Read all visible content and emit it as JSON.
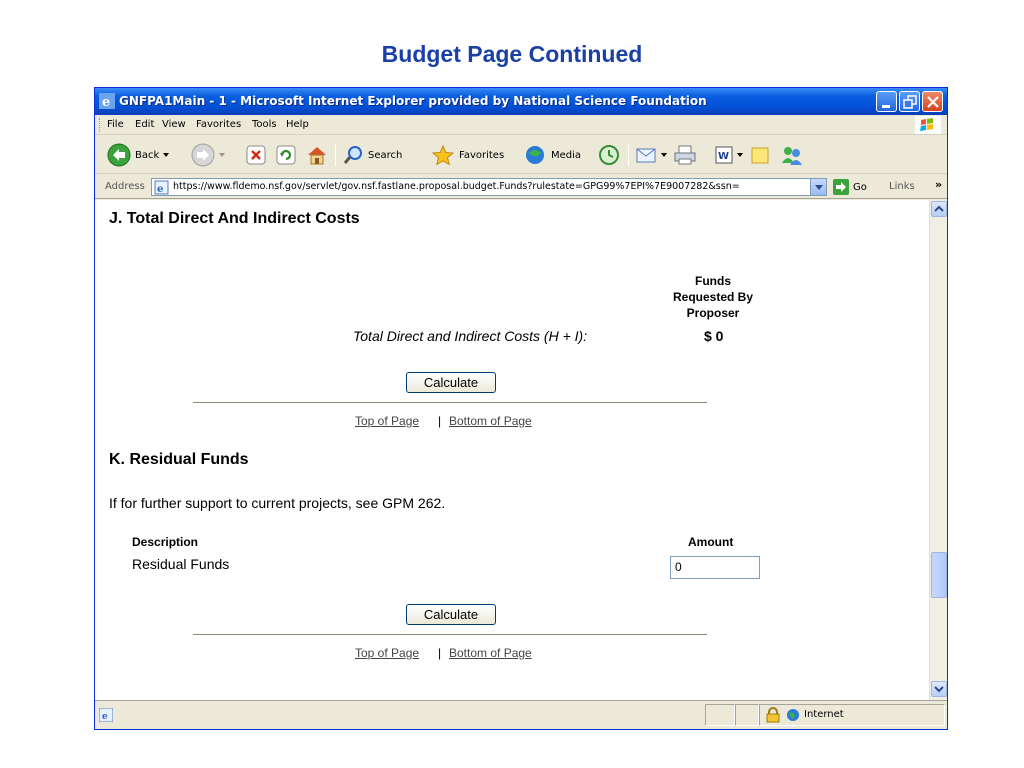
{
  "slide_title": "Budget Page Continued",
  "window": {
    "title": "GNFPA1Main - 1 - Microsoft Internet Explorer provided by National Science Foundation",
    "menu": [
      "File",
      "Edit",
      "View",
      "Favorites",
      "Tools",
      "Help"
    ],
    "toolbar": {
      "back": "Back",
      "search": "Search",
      "favorites": "Favorites",
      "media": "Media"
    },
    "address": {
      "label": "Address",
      "url": "https://www.fldemo.nsf.gov/servlet/gov.nsf.fastlane.proposal.budget.Funds?rulestate=GPG99%7EPI%7E9007282&ssn=",
      "go": "Go",
      "links": "Links"
    },
    "status": {
      "zone": "Internet"
    }
  },
  "page": {
    "section_j": {
      "heading": "J. Total Direct And Indirect Costs",
      "column_header": [
        "Funds",
        "Requested By",
        "Proposer"
      ],
      "row_label": "Total Direct and Indirect Costs (H + I):",
      "row_value": "$ 0",
      "calculate": "Calculate",
      "top_link": "Top of Page",
      "bottom_link": "Bottom of Page"
    },
    "section_k": {
      "heading": "K. Residual Funds",
      "note": "If for further support to current projects, see GPM 262.",
      "col_description": "Description",
      "col_amount": "Amount",
      "row_label": "Residual Funds",
      "row_value": "0",
      "calculate": "Calculate",
      "top_link": "Top of Page",
      "bottom_link": "Bottom of Page"
    }
  }
}
